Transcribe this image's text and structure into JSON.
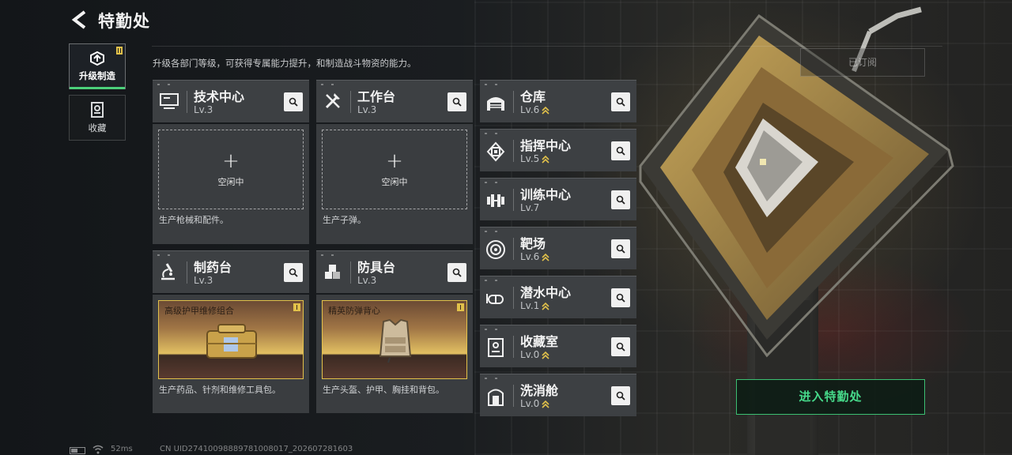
{
  "header": {
    "back_icon": "chevron-left-icon",
    "title": "特勤处",
    "description": "升级各部门等级，可获得专属能力提升，和制造战斗物资的能力。",
    "subscribed_label": "已订阅"
  },
  "sidebar": {
    "items": [
      {
        "label": "升级制造",
        "icon": "upgrade-craft-icon",
        "active": true
      },
      {
        "label": "收藏",
        "icon": "collection-icon",
        "active": false
      }
    ]
  },
  "workshops": [
    {
      "name": "技术中心",
      "level": "Lv.3",
      "icon": "monitor-icon",
      "slot_state": "空闲中",
      "description": "生产枪械和配件。"
    },
    {
      "name": "工作台",
      "level": "Lv.3",
      "icon": "tools-icon",
      "slot_state": "空闲中",
      "description": "生产子弹。"
    },
    {
      "name": "制药台",
      "level": "Lv.3",
      "icon": "microscope-icon",
      "product": "高级护甲维修组合",
      "description": "生产药品、针剂和维修工具包。"
    },
    {
      "name": "防具台",
      "level": "Lv.3",
      "icon": "armor-blocks-icon",
      "product": "精英防弹背心",
      "description": "生产头盔、护甲、胸挂和背包。"
    }
  ],
  "facilities": [
    {
      "name": "仓库",
      "level": "Lv.6",
      "icon": "warehouse-icon",
      "upgradable": true
    },
    {
      "name": "指挥中心",
      "level": "Lv.5",
      "icon": "chip-icon",
      "upgradable": true
    },
    {
      "name": "训练中心",
      "level": "Lv.7",
      "icon": "dumbbell-icon",
      "upgradable": false
    },
    {
      "name": "靶场",
      "level": "Lv.6",
      "icon": "target-icon",
      "upgradable": true
    },
    {
      "name": "潜水中心",
      "level": "Lv.1",
      "icon": "diving-goggles-icon",
      "upgradable": true
    },
    {
      "name": "收藏室",
      "level": "Lv.0",
      "icon": "display-case-icon",
      "upgradable": true
    },
    {
      "name": "洗消舱",
      "level": "Lv.0",
      "icon": "decontamination-icon",
      "upgradable": true
    }
  ],
  "enter_button": "进入特勤处",
  "status_bar": {
    "ping": "52ms",
    "uid": "CN UID274100988897810080​17_202607281603"
  },
  "colors": {
    "accent_green": "#4cd07a",
    "upgrade_gold": "#e2c14a",
    "card_bg": "#3d4043"
  }
}
